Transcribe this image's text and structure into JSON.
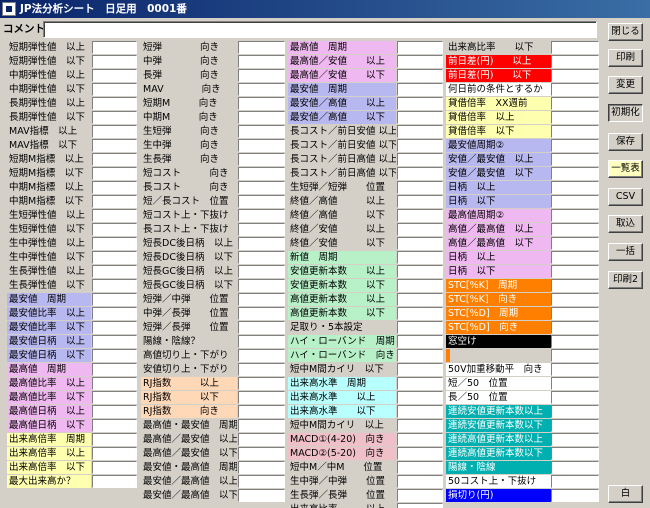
{
  "window": {
    "title": "JP法分析シート　日足用　0001番"
  },
  "comment": {
    "label": "コメント",
    "value": ""
  },
  "columns": [
    {
      "rows": [
        {
          "label": "短期弾性値　以上",
          "bg": "#d4d0c8"
        },
        {
          "label": "短期弾性値　以下",
          "bg": "#d4d0c8"
        },
        {
          "label": "中期弾性値　以上",
          "bg": "#d4d0c8"
        },
        {
          "label": "中期弾性値　以下",
          "bg": "#d4d0c8"
        },
        {
          "label": "長期弾性値　以上",
          "bg": "#d4d0c8"
        },
        {
          "label": "長期弾性値　以下",
          "bg": "#d4d0c8"
        },
        {
          "label": "MAV指標　以上",
          "bg": "#d4d0c8"
        },
        {
          "label": "MAV指標　以下",
          "bg": "#d4d0c8"
        },
        {
          "label": "短期M指標　以上",
          "bg": "#d4d0c8"
        },
        {
          "label": "短期M指標　以下",
          "bg": "#d4d0c8"
        },
        {
          "label": "中期M指標　以上",
          "bg": "#d4d0c8"
        },
        {
          "label": "中期M指標　以下",
          "bg": "#d4d0c8"
        },
        {
          "label": "生短弾性値　以上",
          "bg": "#d4d0c8"
        },
        {
          "label": "生短弾性値　以下",
          "bg": "#d4d0c8"
        },
        {
          "label": "生中弾性値　以上",
          "bg": "#d4d0c8"
        },
        {
          "label": "生中弾性値　以下",
          "bg": "#d4d0c8"
        },
        {
          "label": "生長弾性値　以上",
          "bg": "#d4d0c8"
        },
        {
          "label": "生長弾性値　以下",
          "bg": "#d4d0c8"
        },
        {
          "label": "最安値　周期",
          "bg": "#b8b8f0"
        },
        {
          "label": "最安値比率　以上",
          "bg": "#b8b8f0"
        },
        {
          "label": "最安値比率　以下",
          "bg": "#b8b8f0"
        },
        {
          "label": "最安値日柄　以上",
          "bg": "#b8b8f0"
        },
        {
          "label": "最安値日柄　以下",
          "bg": "#b8b8f0"
        },
        {
          "label": "最高値　周期",
          "bg": "#f0b8f0"
        },
        {
          "label": "最高値比率　以上",
          "bg": "#f0b8f0"
        },
        {
          "label": "最高値比率　以下",
          "bg": "#f0b8f0"
        },
        {
          "label": "最高値日柄　以上",
          "bg": "#f0b8f0"
        },
        {
          "label": "最高値日柄　以下",
          "bg": "#f0b8f0"
        },
        {
          "label": "出来高倍率　周期",
          "bg": "#ffffb0"
        },
        {
          "label": "出来高倍率　以上",
          "bg": "#ffffb0"
        },
        {
          "label": "出来高倍率　以下",
          "bg": "#ffffb0"
        },
        {
          "label": "最大出来高か？",
          "bg": "#ffffb0"
        }
      ]
    },
    {
      "rows": [
        {
          "label": "短弾　　　　向き",
          "bg": "#d4d0c8"
        },
        {
          "label": "中弾　　　　向き",
          "bg": "#d4d0c8"
        },
        {
          "label": "長弾　　　　向き",
          "bg": "#d4d0c8"
        },
        {
          "label": "MAV　　　　向き",
          "bg": "#d4d0c8"
        },
        {
          "label": "短期M　　　向き",
          "bg": "#d4d0c8"
        },
        {
          "label": "中期M　　　向き",
          "bg": "#d4d0c8"
        },
        {
          "label": "生短弾　　　向き",
          "bg": "#d4d0c8"
        },
        {
          "label": "生中弾　　　向き",
          "bg": "#d4d0c8"
        },
        {
          "label": "生長弾　　　向き",
          "bg": "#d4d0c8"
        },
        {
          "label": "短コスト　　　向き",
          "bg": "#d4d0c8"
        },
        {
          "label": "長コスト　　　向き",
          "bg": "#d4d0c8"
        },
        {
          "label": "短／長コスト　位置",
          "bg": "#d4d0c8"
        },
        {
          "label": "短コスト上・下抜け",
          "bg": "#d4d0c8"
        },
        {
          "label": "長コスト上・下抜け",
          "bg": "#d4d0c8"
        },
        {
          "label": "短長DC後日柄　以上",
          "bg": "#d4d0c8"
        },
        {
          "label": "短長DC後日柄　以下",
          "bg": "#d4d0c8"
        },
        {
          "label": "短長GC後日柄　以上",
          "bg": "#d4d0c8"
        },
        {
          "label": "短長GC後日柄　以下",
          "bg": "#d4d0c8"
        },
        {
          "label": "短弾／中弾　　位置",
          "bg": "#d4d0c8"
        },
        {
          "label": "中弾／長弾　　位置",
          "bg": "#d4d0c8"
        },
        {
          "label": "短弾／長弾　　位置",
          "bg": "#d4d0c8"
        },
        {
          "label": "陽線・陰線？",
          "bg": "#d4d0c8"
        },
        {
          "label": "高値切り上・下がり",
          "bg": "#d4d0c8"
        },
        {
          "label": "安値切り上・下がり",
          "bg": "#d4d0c8"
        },
        {
          "label": "RJ指数　　　以上",
          "bg": "#ffd8b8"
        },
        {
          "label": "RJ指数　　　以下",
          "bg": "#ffd8b8"
        },
        {
          "label": "RJ指数　　　向き",
          "bg": "#ffd8b8"
        },
        {
          "label": "最高値・最安値　周期",
          "bg": "#d4d0c8"
        },
        {
          "label": "最高値／最安値　以上",
          "bg": "#d4d0c8"
        },
        {
          "label": "最高値／最安値　以下",
          "bg": "#d4d0c8"
        },
        {
          "label": "最安値・最高値　周期",
          "bg": "#d4d0c8"
        },
        {
          "label": "最安値／最高値　以上",
          "bg": "#d4d0c8"
        },
        {
          "label": "最安値／最高値　以下",
          "bg": "#d4d0c8"
        }
      ]
    },
    {
      "rows": [
        {
          "label": "最高値　周期",
          "bg": "#f0b8f0"
        },
        {
          "label": "最高値／安値　　以上",
          "bg": "#f0b8f0"
        },
        {
          "label": "最高値／安値　　以下",
          "bg": "#f0b8f0"
        },
        {
          "label": "最安値　周期",
          "bg": "#b8b8f0"
        },
        {
          "label": "最安値／高値　　以上",
          "bg": "#b8b8f0"
        },
        {
          "label": "最安値／高値　　以下",
          "bg": "#b8b8f0"
        },
        {
          "label": "長コスト／前日安値 以上",
          "bg": "#d4d0c8"
        },
        {
          "label": "長コスト／前日安値 以下",
          "bg": "#d4d0c8"
        },
        {
          "label": "長コスト／前日高値 以上",
          "bg": "#d4d0c8"
        },
        {
          "label": "長コスト／前日高値 以下",
          "bg": "#d4d0c8"
        },
        {
          "label": "生短弾／短弾　　位置",
          "bg": "#d4d0c8"
        },
        {
          "label": "終値／高値　　　以上",
          "bg": "#d4d0c8"
        },
        {
          "label": "終値／高値　　　以下",
          "bg": "#d4d0c8"
        },
        {
          "label": "終値／安値　　　以上",
          "bg": "#d4d0c8"
        },
        {
          "label": "終値／安値　　　以下",
          "bg": "#d4d0c8"
        },
        {
          "label": "新値　周期",
          "bg": "#b8f0c8"
        },
        {
          "label": "安値更新本数　　以上",
          "bg": "#b8f0c8"
        },
        {
          "label": "安値更新本数　　以下",
          "bg": "#b8f0c8"
        },
        {
          "label": "高値更新本数　　以上",
          "bg": "#b8f0c8"
        },
        {
          "label": "高値更新本数　　以下",
          "bg": "#b8f0c8"
        },
        {
          "label": "足取り・5本設定",
          "bg": "#d4d0c8"
        },
        {
          "label": "ハイ・ローバンド　周期",
          "bg": "#b8f0c8"
        },
        {
          "label": "ハイ・ローバンド　向き",
          "bg": "#b8f0c8"
        },
        {
          "label": "短中M間カイリ　以下",
          "bg": "#d4d0c8"
        },
        {
          "label": "出来高水準　周期",
          "bg": "#b8ffff"
        },
        {
          "label": "出来高水準　　以上",
          "bg": "#b8ffff"
        },
        {
          "label": "出来高水準　　以下",
          "bg": "#b8ffff"
        },
        {
          "label": "短中M間カイリ　以上",
          "bg": "#d4d0c8"
        },
        {
          "label": "MACD①(4-20)　向き",
          "bg": "#f0c0c8"
        },
        {
          "label": "MACD②(5-20)　向き",
          "bg": "#f0c0c8"
        },
        {
          "label": "短中M／中M　　位置",
          "bg": "#d4d0c8"
        },
        {
          "label": "生中弾／中弾　　位置",
          "bg": "#d4d0c8"
        },
        {
          "label": "生長弾／長弾　　位置",
          "bg": "#d4d0c8"
        },
        {
          "label": "出来高比率　　　以上",
          "bg": "#d4d0c8"
        }
      ]
    },
    {
      "rows": [
        {
          "label": "出来高比率　　以下",
          "bg": "#d4d0c8",
          "color": "#000"
        },
        {
          "label": "前日差(円)　　以上",
          "bg": "#ff0000",
          "color": "#ffffff"
        },
        {
          "label": "前日差(円)　　以下",
          "bg": "#ff0000",
          "color": "#ffffff"
        },
        {
          "label": "何日前の条件とするか",
          "bg": "#ffffff",
          "color": "#000"
        },
        {
          "label": "貸借倍率　XX週前",
          "bg": "#ffffb0",
          "color": "#000"
        },
        {
          "label": "貸借倍率　以上",
          "bg": "#ffffb0",
          "color": "#000"
        },
        {
          "label": "貸借倍率　以下",
          "bg": "#ffffb0",
          "color": "#000"
        },
        {
          "label": "最安値周期②",
          "bg": "#b8b8f0",
          "color": "#000"
        },
        {
          "label": "安値／最安値　以上",
          "bg": "#b8b8f0",
          "color": "#000"
        },
        {
          "label": "安値／最安値　以下",
          "bg": "#b8b8f0",
          "color": "#000"
        },
        {
          "label": "日柄　以上",
          "bg": "#b8b8f0",
          "color": "#000"
        },
        {
          "label": "日柄　以下",
          "bg": "#b8b8f0",
          "color": "#000"
        },
        {
          "label": "最高値周期②",
          "bg": "#f0b8f0",
          "color": "#000"
        },
        {
          "label": "高値／最高値　以上",
          "bg": "#f0b8f0",
          "color": "#000"
        },
        {
          "label": "高値／最高値　以下",
          "bg": "#f0b8f0",
          "color": "#000"
        },
        {
          "label": "日柄　以上",
          "bg": "#f0b8f0",
          "color": "#000"
        },
        {
          "label": "日柄　以下",
          "bg": "#f0b8f0",
          "color": "#000"
        },
        {
          "label": "STC[%K]　周期",
          "bg": "#ff8000",
          "color": "#ffffff"
        },
        {
          "label": "STC[%K]　向き",
          "bg": "#ff8000",
          "color": "#ffffff"
        },
        {
          "label": "STC[%D]　周期",
          "bg": "#ff8000",
          "color": "#ffffff"
        },
        {
          "label": "STC[%D]　向き",
          "bg": "#ff8000",
          "color": "#ffffff"
        },
        {
          "label": "窓空け",
          "bg": "#000000",
          "color": "#ffffff"
        },
        {
          "label": "",
          "bg": "#ff8000",
          "color": "#000",
          "stub": true
        },
        {
          "label": "50V加重移動平　向き",
          "bg": "#ffffff",
          "color": "#000"
        },
        {
          "label": "短／50　位置",
          "bg": "#ffffff",
          "color": "#000"
        },
        {
          "label": "長／50　位置",
          "bg": "#ffffff",
          "color": "#000"
        },
        {
          "label": "連続安値更新本数以上",
          "bg": "#00b0b0",
          "color": "#ffffff"
        },
        {
          "label": "連続安値更新本数以下",
          "bg": "#00b0b0",
          "color": "#ffffff"
        },
        {
          "label": "連続高値更新本数以上",
          "bg": "#00b0b0",
          "color": "#ffffff"
        },
        {
          "label": "連続高値更新本数以下",
          "bg": "#00b0b0",
          "color": "#ffffff"
        },
        {
          "label": "陽線・陰線",
          "bg": "#00b0b0",
          "color": "#ffffff"
        },
        {
          "label": "50コスト上・下抜け",
          "bg": "#ffffff",
          "color": "#000"
        },
        {
          "label": "損切り(円)",
          "bg": "#0000ff",
          "color": "#ffffff"
        }
      ]
    }
  ],
  "buttons": [
    {
      "label": "閉じる",
      "style": "normal"
    },
    {
      "label": "印刷",
      "style": "normal"
    },
    {
      "label": "変更",
      "style": "normal"
    },
    {
      "label": "初期化",
      "style": "pressed"
    },
    {
      "label": "保存",
      "style": "normal"
    },
    {
      "label": "一覧表",
      "style": "yellow"
    },
    {
      "label": "CSV",
      "style": "normal"
    },
    {
      "label": "取込",
      "style": "normal"
    },
    {
      "label": "一括",
      "style": "normal"
    },
    {
      "label": "印刷2",
      "style": "normal"
    },
    {
      "label": "白",
      "style": "normal"
    }
  ]
}
